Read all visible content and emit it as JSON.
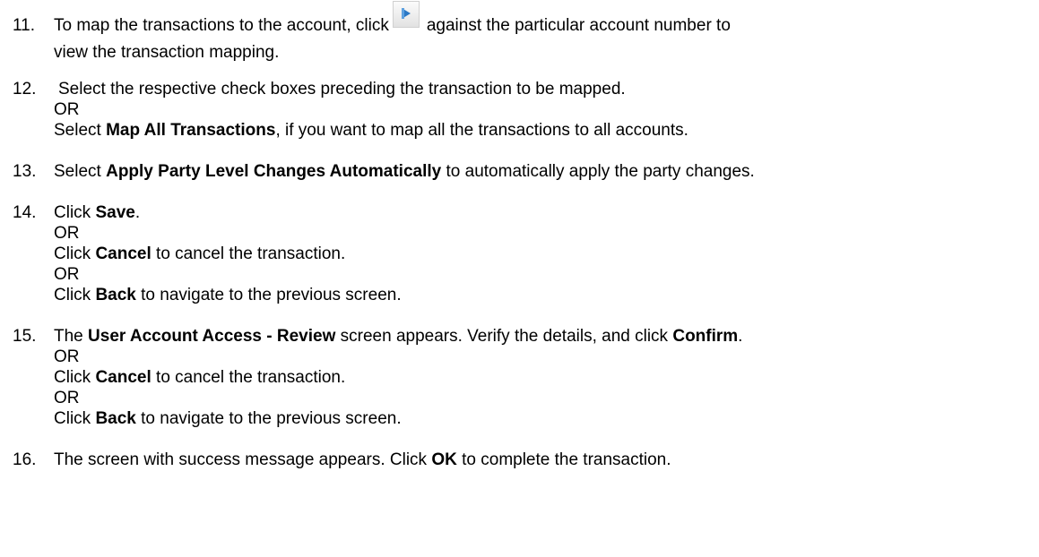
{
  "steps": [
    {
      "num": "11.",
      "l1a": "To map the transactions to the account, click",
      "l1b": "against the particular account number to",
      "l2": "view the transaction mapping.",
      "icon": "expand-arrow-icon"
    },
    {
      "num": "12.",
      "l1": "Select the respective check boxes preceding the transaction to be mapped.",
      "or": "OR",
      "l3a": "Select ",
      "l3b": "Map All Transactions",
      "l3c": ", if you want to map all the transactions to all accounts."
    },
    {
      "num": "13.",
      "a": "Select ",
      "b": "Apply Party Level Changes Automatically",
      "c": " to automatically apply the party changes."
    },
    {
      "num": "14.",
      "l1a": "Click ",
      "l1b": "Save",
      "l1c": ".",
      "or1": "OR",
      "l3a": "Click ",
      "l3b": "Cancel",
      "l3c": " to cancel the transaction.",
      "or2": "OR",
      "l5a": "Click ",
      "l5b": "Back",
      "l5c": " to navigate to the previous screen."
    },
    {
      "num": "15.",
      "l1a": "The ",
      "l1b": "User Account Access - Review",
      "l1c": " screen appears. Verify the details, and click ",
      "l1d": "Confirm",
      "l1e": ".",
      "or1": "OR",
      "l3a": "Click ",
      "l3b": "Cancel",
      "l3c": " to cancel the transaction.",
      "or2": "OR",
      "l5a": "Click ",
      "l5b": "Back",
      "l5c": " to navigate to the previous screen."
    },
    {
      "num": "16.",
      "a": "The screen with success message appears. Click ",
      "b": "OK",
      "c": " to complete the transaction."
    }
  ]
}
